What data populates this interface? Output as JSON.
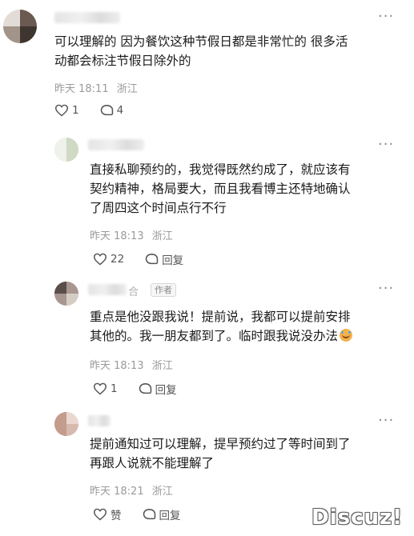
{
  "comments": [
    {
      "id": "c1",
      "text_lines": [
        "可以理解的 因为餐饮这种节假日都是非常忙的 很多活",
        "动都会标注节假日除外的"
      ],
      "time": "昨天 18:11",
      "location": "浙江",
      "likes": "1",
      "replies": "4"
    },
    {
      "id": "c2",
      "text_lines": [
        "直接私聊预约的，我觉得既然约成了，就应该有",
        "契约精神，格局要大，而且我看博主还特地确认",
        "了周四这个时间点行不行"
      ],
      "time": "昨天 18:13",
      "location": "浙江",
      "likes": "22",
      "reply_label": "回复"
    },
    {
      "id": "c3",
      "name_tail": "合",
      "author_tag": "作者",
      "text_lines": [
        "重点是他没跟我说！提前说，我都可以提前安排",
        "其他的。我一朋友都到了。临时跟我说没办法"
      ],
      "emoji": "sad-emoji",
      "time": "昨天 18:13",
      "location": "浙江",
      "likes": "1",
      "reply_label": "回复"
    },
    {
      "id": "c4",
      "text_lines": [
        "提前通知过可以理解，提早预约过了等时间到了",
        "再跟人说就不能理解了"
      ],
      "time": "昨天 18:21",
      "location": "浙江",
      "likes": "赞",
      "reply_label": "回复"
    }
  ],
  "icons": {
    "more": "more-dots-icon",
    "like": "heart-icon",
    "comment": "comment-bubble-icon"
  },
  "watermark": "Discuz!",
  "colors": {
    "text": "#1a1a1a",
    "meta": "#9a9a9a",
    "action": "#555555"
  }
}
